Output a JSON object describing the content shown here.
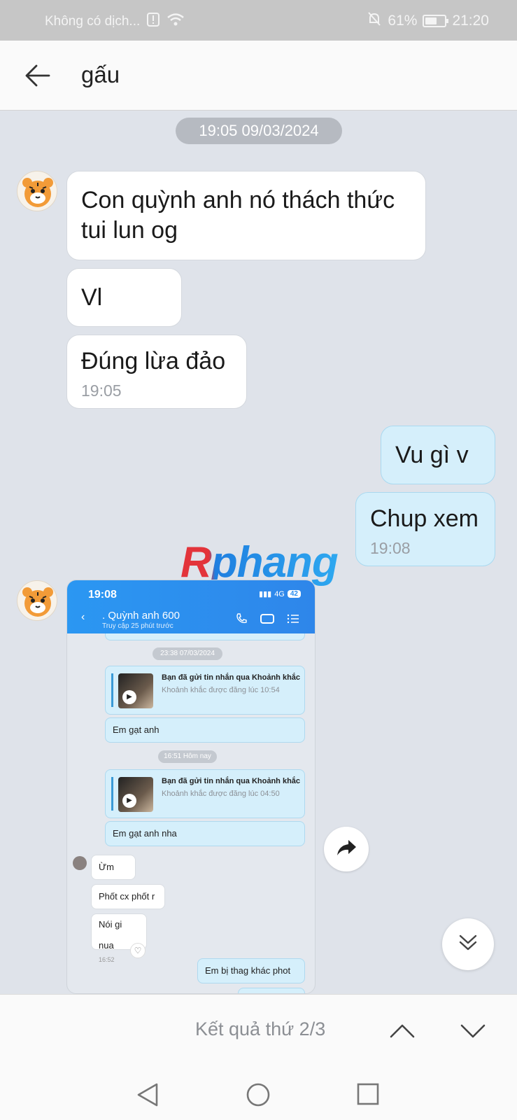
{
  "status": {
    "carrier": "Không có dịch...",
    "battery": "61%",
    "time": "21:20",
    "battery_level": 0.61
  },
  "header": {
    "title": "gấu"
  },
  "chat": {
    "date_separator": "19:05 09/03/2024",
    "messages": [
      {
        "from": "other",
        "text": "Con quỳnh anh nó thách thức tui lun og"
      },
      {
        "from": "other",
        "text": "Vl"
      },
      {
        "from": "other",
        "text": "Đúng lừa đảo",
        "time": "19:05"
      },
      {
        "from": "me",
        "text": "Vu gì v"
      },
      {
        "from": "me",
        "text": "Chup xem",
        "time": "19:08"
      }
    ]
  },
  "watermark": {
    "text": "Rphang"
  },
  "screenshot": {
    "time": "19:08",
    "network": "4G",
    "battery": "42",
    "contact_name": ". Quỳnh anh 600",
    "contact_status": "Truy cập 25 phút trước",
    "date1": "23:38 07/03/2024",
    "moment1_title": "Bạn đã gửi tin nhắn qua Khoảnh khắc",
    "moment1_sub": "Khoảnh khắc được đăng lúc 10:54",
    "msg1": "Em gạt anh",
    "date2": "16:51 Hôm nay",
    "moment2_title": "Bạn đã gửi tin nhắn qua Khoảnh khắc",
    "moment2_sub": "Khoảnh khắc được đăng lúc 04:50",
    "msg2": "Em gạt anh nha",
    "reply1": "Ừm",
    "reply2": "Phốt cx phốt r",
    "reply3": "Nói gi nua",
    "reply3_time": "16:52",
    "msg3": "Em bị thag khác phot"
  },
  "search": {
    "result": "Kết quả thứ 2/3"
  }
}
